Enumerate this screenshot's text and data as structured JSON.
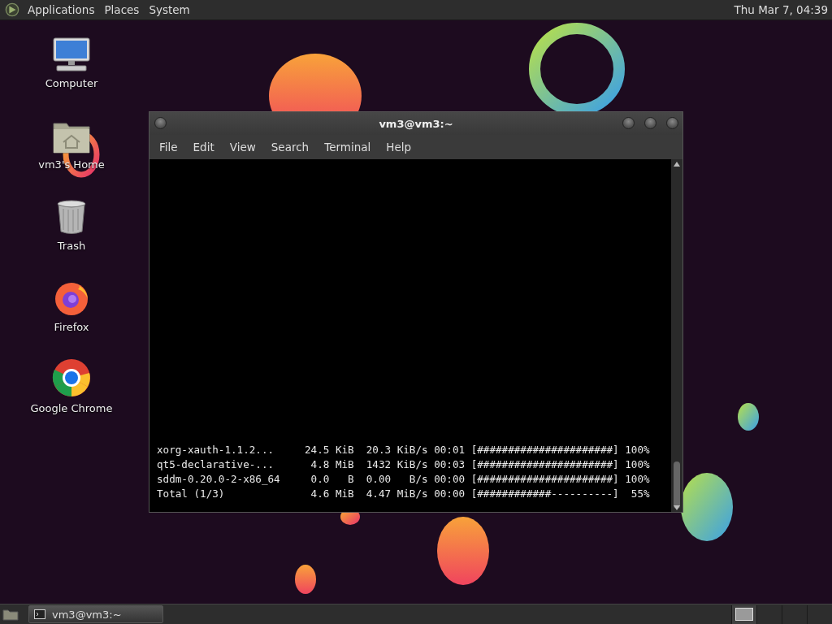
{
  "top_panel": {
    "menus": [
      "Applications",
      "Places",
      "System"
    ],
    "clock": "Thu Mar 7, 04:39"
  },
  "desktop_icons": [
    {
      "kind": "computer",
      "label": "Computer"
    },
    {
      "kind": "home",
      "label": "vm3's Home"
    },
    {
      "kind": "trash",
      "label": "Trash"
    },
    {
      "kind": "firefox",
      "label": "Firefox"
    },
    {
      "kind": "chrome",
      "label": "Google Chrome"
    }
  ],
  "terminal": {
    "title": "vm3@vm3:~",
    "menu": [
      "File",
      "Edit",
      "View",
      "Search",
      "Terminal",
      "Help"
    ],
    "lines": [
      "xorg-xauth-1.1.2...     24.5 KiB  20.3 KiB/s 00:01 [######################] 100%",
      "qt5-declarative-...      4.8 MiB  1432 KiB/s 00:03 [######################] 100%",
      "sddm-0.20.0-2-x86_64     0.0   B  0.00   B/s 00:00 [######################] 100%",
      "Total (1/3)              4.6 MiB  4.47 MiB/s 00:00 [############----------]  55%"
    ]
  },
  "bottom_panel": {
    "tasks": [
      {
        "label": "vm3@vm3:~",
        "selected": true
      }
    ],
    "workspaces": [
      {
        "selected": true
      },
      {
        "selected": false
      },
      {
        "selected": false
      },
      {
        "selected": false
      }
    ]
  }
}
